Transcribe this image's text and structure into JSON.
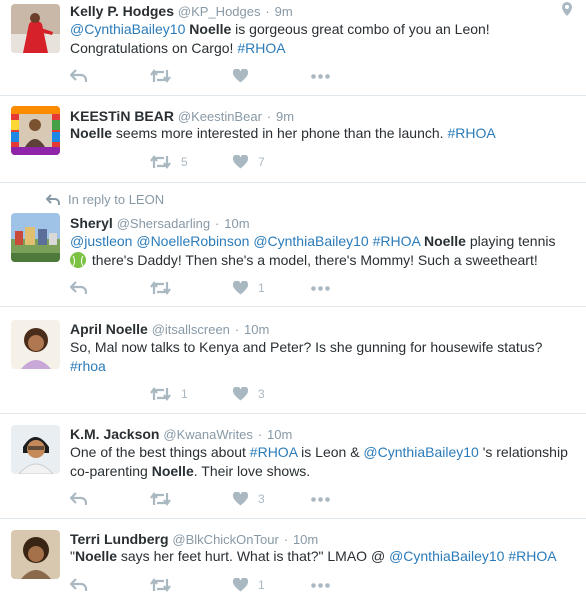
{
  "colors": {
    "link": "#2b7bb9",
    "muted": "#8899a6",
    "icon": "#aab8c2",
    "text": "#292f33",
    "divider": "#e1e8ed"
  },
  "tweets": [
    {
      "name": "Kelly P. Hodges",
      "handle": "@KP_Hodges",
      "sep": "·",
      "time": "9m",
      "text": [
        {
          "t": "@CynthiaBailey10",
          "k": "link"
        },
        {
          "t": " "
        },
        {
          "t": "Noelle",
          "k": "bold"
        },
        {
          "t": " is gorgeous great combo of you an Leon! Congratulations on Cargo! "
        },
        {
          "t": "#RHOA",
          "k": "link"
        }
      ],
      "retweets": "",
      "likes": "",
      "geo_icon": "location-pin-icon"
    },
    {
      "name": "KEESTiN BEAR",
      "handle": "@KeestinBear",
      "sep": "·",
      "time": "9m",
      "text": [
        {
          "t": "Noelle",
          "k": "bold"
        },
        {
          "t": " seems more interested in her phone than the launch. "
        },
        {
          "t": "#RHOA",
          "k": "link"
        }
      ],
      "retweets": "5",
      "likes": "7"
    },
    {
      "in_reply_to": "In reply to LEON",
      "name": "Sheryl",
      "handle": "@Shersadarling",
      "sep": "·",
      "time": "10m",
      "text": [
        {
          "t": "@justleon",
          "k": "link"
        },
        {
          "t": " "
        },
        {
          "t": "@NoelleRobinson",
          "k": "link"
        },
        {
          "t": " "
        },
        {
          "t": "@CynthiaBailey10",
          "k": "link"
        },
        {
          "t": " "
        },
        {
          "t": "#RHOA",
          "k": "link"
        },
        {
          "t": " "
        },
        {
          "t": "Noelle",
          "k": "bold"
        },
        {
          "t": " playing tennis "
        },
        {
          "t": "",
          "k": "tennis"
        },
        {
          "t": " there's Daddy! Then she's a model, there's Mommy! Such a sweetheart!"
        }
      ],
      "retweets": "",
      "likes": "1"
    },
    {
      "name": "April Noelle",
      "handle": "@itsallscreen",
      "sep": "·",
      "time": "10m",
      "text": [
        {
          "t": "So, Mal now talks to Kenya and Peter? Is she gunning for housewife status? "
        },
        {
          "t": "#rhoa",
          "k": "link"
        }
      ],
      "retweets": "1",
      "likes": "3"
    },
    {
      "name": "K.M. Jackson",
      "handle": "@KwanaWrites",
      "sep": "·",
      "time": "10m",
      "text": [
        {
          "t": "One of the best things about "
        },
        {
          "t": "#RHOA",
          "k": "link"
        },
        {
          "t": " is Leon & "
        },
        {
          "t": "@CynthiaBailey10",
          "k": "link"
        },
        {
          "t": " 's relationship co-parenting "
        },
        {
          "t": "Noelle",
          "k": "bold"
        },
        {
          "t": ". Their love shows."
        }
      ],
      "retweets": "",
      "likes": "3"
    },
    {
      "name": "Terri Lundberg",
      "handle": "@BlkChickOnTour",
      "sep": "·",
      "time": "10m",
      "text": [
        {
          "t": "\""
        },
        {
          "t": "Noelle",
          "k": "bold"
        },
        {
          "t": " says her feet hurt. What is that?\" LMAO @ "
        },
        {
          "t": "@CynthiaBailey10",
          "k": "link"
        },
        {
          "t": "  "
        },
        {
          "t": "#RHOA",
          "k": "link"
        }
      ],
      "retweets": "",
      "likes": "1"
    }
  ]
}
